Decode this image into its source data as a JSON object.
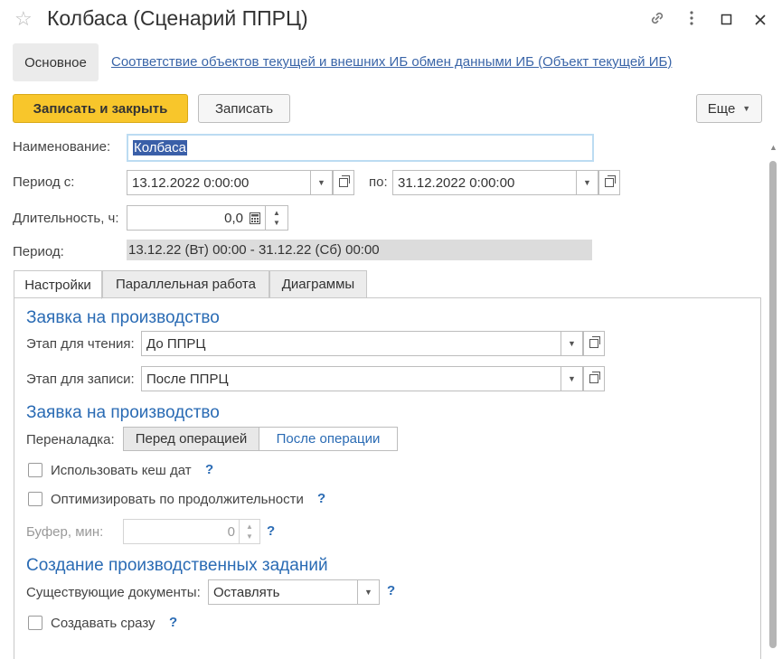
{
  "window": {
    "title": "Колбаса (Сценарий ППРЦ)"
  },
  "nav": {
    "tab_main": "Основное",
    "link": "Соответствие объектов текущей и внешних ИБ обмен данными ИБ (Объект текущей ИБ)"
  },
  "toolbar": {
    "save_close": "Записать и закрыть",
    "save": "Записать",
    "more": "Еще"
  },
  "form": {
    "name_label": "Наименование:",
    "name_value": "Колбаса",
    "period_from_label": "Период с:",
    "period_from_value": "13.12.2022 0:00:00",
    "period_to_label": "по:",
    "period_to_value": "31.12.2022 0:00:00",
    "duration_label": "Длительность, ч:",
    "duration_value": "0,0",
    "period_label": "Период:",
    "period_value": "13.12.22 (Вт) 00:00 - 31.12.22 (Сб) 00:00"
  },
  "tabs": [
    "Настройки",
    "Параллельная работа",
    "Диаграммы"
  ],
  "settings": {
    "section1_title": "Заявка на производство",
    "read_stage_label": "Этап для чтения:",
    "read_stage_value": "До ППРЦ",
    "write_stage_label": "Этап для записи:",
    "write_stage_value": "После ППРЦ",
    "section2_title": "Заявка на производство",
    "changeover_label": "Переналадка:",
    "changeover_options": [
      "Перед операцией",
      "После операции"
    ],
    "changeover_selected": "Перед операцией",
    "use_cache_label": "Использовать кеш дат",
    "use_cache_checked": false,
    "optimize_label": "Оптимизировать по продолжительности",
    "optimize_checked": false,
    "buffer_label": "Буфер, мин:",
    "buffer_value": "0",
    "section3_title": "Создание производственных заданий",
    "existing_docs_label": "Существующие документы:",
    "existing_docs_value": "Оставлять",
    "create_now_label": "Создавать сразу",
    "create_now_checked": false,
    "help_mark": "?"
  }
}
